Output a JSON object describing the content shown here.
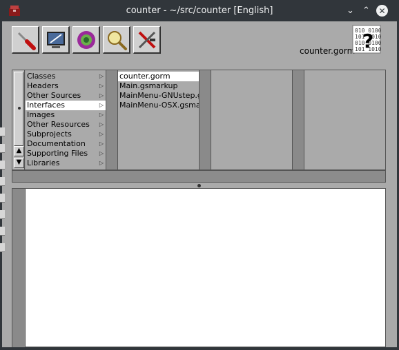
{
  "window": {
    "title": "counter - ~/src/counter [English]",
    "buttons": {
      "minimize": "⌄",
      "maximize": "⌃",
      "close": "✕"
    }
  },
  "toolbar": {
    "tools": [
      {
        "name": "build-tool",
        "icon": "screwdriver-icon"
      },
      {
        "name": "run-tool",
        "icon": "monitor-icon"
      },
      {
        "name": "loaded-files-tool",
        "icon": "bundle-icon"
      },
      {
        "name": "find-tool",
        "icon": "magnifier-icon"
      },
      {
        "name": "launch-tool",
        "icon": "tools-icon"
      }
    ],
    "document_label": "counter.gorm",
    "help_icon": "help-icon"
  },
  "browser": {
    "categories": [
      "Classes",
      "Headers",
      "Other Sources",
      "Interfaces",
      "Images",
      "Other Resources",
      "Subprojects",
      "Documentation",
      "Supporting Files",
      "Libraries"
    ],
    "selected_category": "Interfaces",
    "files": [
      "counter.gorm",
      "Main.gsmarkup",
      "MainMenu-GNUstep.gsmarkup",
      "MainMenu-OSX.gsmarkup"
    ],
    "selected_file": "counter.gorm"
  },
  "colors": {
    "window_bg": "#aaaaaa",
    "titlebar_bg": "#31363b",
    "selection": "#ffffff"
  }
}
